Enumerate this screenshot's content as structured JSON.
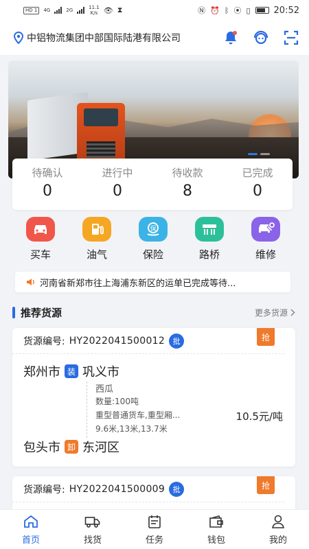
{
  "status_bar": {
    "net_chip": "HD 1",
    "net1": "4G",
    "net2": "2G",
    "speed_value": "11.1",
    "speed_unit": "K/s",
    "time": "20:52"
  },
  "header": {
    "company": "中铝物流集团中部国际陆港有限公司",
    "icons": [
      "location-pin-icon",
      "bell-icon",
      "customer-service-icon",
      "scan-icon"
    ]
  },
  "banner": {
    "active_slide": 1,
    "slide_count": 2
  },
  "stats": [
    {
      "label": "待确认",
      "value": "0"
    },
    {
      "label": "进行中",
      "value": "0"
    },
    {
      "label": "待收款",
      "value": "8"
    },
    {
      "label": "已完成",
      "value": "0"
    }
  ],
  "services": [
    {
      "label": "买车",
      "icon": "car-icon",
      "color": "#f0574a"
    },
    {
      "label": "油气",
      "icon": "fuel-icon",
      "color": "#f5a623"
    },
    {
      "label": "保险",
      "icon": "insurance-icon",
      "color": "#3bb3e6"
    },
    {
      "label": "路桥",
      "icon": "toll-bridge-icon",
      "color": "#2cc09a"
    },
    {
      "label": "维修",
      "icon": "repair-icon",
      "color": "#8a63e8"
    }
  ],
  "notice": {
    "text": "河南省新郑市往上海浦东新区的运单已完成等待..."
  },
  "section": {
    "title": "推荐货源",
    "more": "更多货源"
  },
  "cards": [
    {
      "id_label": "货源编号:",
      "id": "HY2022041500012",
      "badge": "批",
      "grab": "抢",
      "from_city": "郑州市",
      "load_tag": "装",
      "from_district": "巩义市",
      "goods": "西瓜",
      "quantity": "数量:100吨",
      "vehicle": "重型普通货车,重型厢...",
      "lengths": "9.6米,13米,13.7米",
      "price": "10.5元/吨",
      "to_city": "包头市",
      "unload_tag": "卸",
      "to_district": "东河区"
    },
    {
      "id_label": "货源编号:",
      "id": "HY2022041500009",
      "badge": "批",
      "grab": "抢"
    }
  ],
  "tabs": [
    {
      "label": "首页",
      "active": true,
      "icon": "home-icon"
    },
    {
      "label": "找货",
      "active": false,
      "icon": "truck-icon"
    },
    {
      "label": "任务",
      "active": false,
      "icon": "task-icon"
    },
    {
      "label": "钱包",
      "active": false,
      "icon": "wallet-icon"
    },
    {
      "label": "我的",
      "active": false,
      "icon": "user-icon"
    }
  ],
  "colors": {
    "primary": "#2a6be0",
    "accent": "#ef7a2c"
  }
}
